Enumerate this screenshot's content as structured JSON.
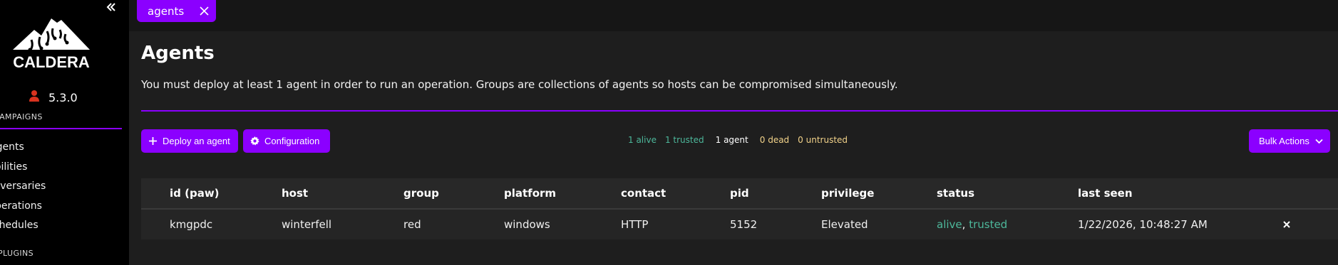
{
  "sidebar": {
    "logo_text": "CALDERA",
    "version": "5.3.0",
    "section_campaigns": "CAMPAIGNS",
    "section_plugins": "PLUGINS",
    "items": [
      {
        "label": "Agents"
      },
      {
        "label": "Abilities"
      },
      {
        "label": "Adversaries"
      },
      {
        "label": "Operations"
      },
      {
        "label": "Schedules"
      }
    ]
  },
  "tabs": [
    {
      "label": "agents"
    }
  ],
  "page": {
    "title": "Agents",
    "description": "You must deploy at least 1 agent in order to run an operation. Groups are collections of agents so hosts can be compromised simultaneously."
  },
  "toolbar": {
    "deploy_label": "Deploy an agent",
    "config_label": "Configuration",
    "bulk_label": "Bulk Actions"
  },
  "stats": {
    "alive": "1 alive",
    "trusted": "1 trusted",
    "agents": "1 agent",
    "dead": "0 dead",
    "untrusted": "0 untrusted"
  },
  "table": {
    "headers": [
      "id (paw)",
      "host",
      "group",
      "platform",
      "contact",
      "pid",
      "privilege",
      "status",
      "last seen"
    ],
    "rows": [
      {
        "paw": "kmgpdc",
        "host": "winterfell",
        "group": "red",
        "platform": "windows",
        "contact": "HTTP",
        "pid": "5152",
        "privilege": "Elevated",
        "status_alive": "alive",
        "status_sep": ",",
        "status_trusted": "trusted",
        "last_seen": "1/22/2026, 10:48:27 AM"
      }
    ]
  },
  "icons": {
    "collapse": "double-chevron-left-icon",
    "user": "user-icon",
    "tab_close": "close-icon",
    "deploy": "plus-icon",
    "config": "gear-icon",
    "bulk": "chevron-down-icon",
    "row_delete": "close-icon"
  },
  "colors": {
    "accent": "#8b00ff",
    "status_green": "#4db89b",
    "status_yellow": "#f3d38a",
    "user_icon": "#d9331f"
  }
}
